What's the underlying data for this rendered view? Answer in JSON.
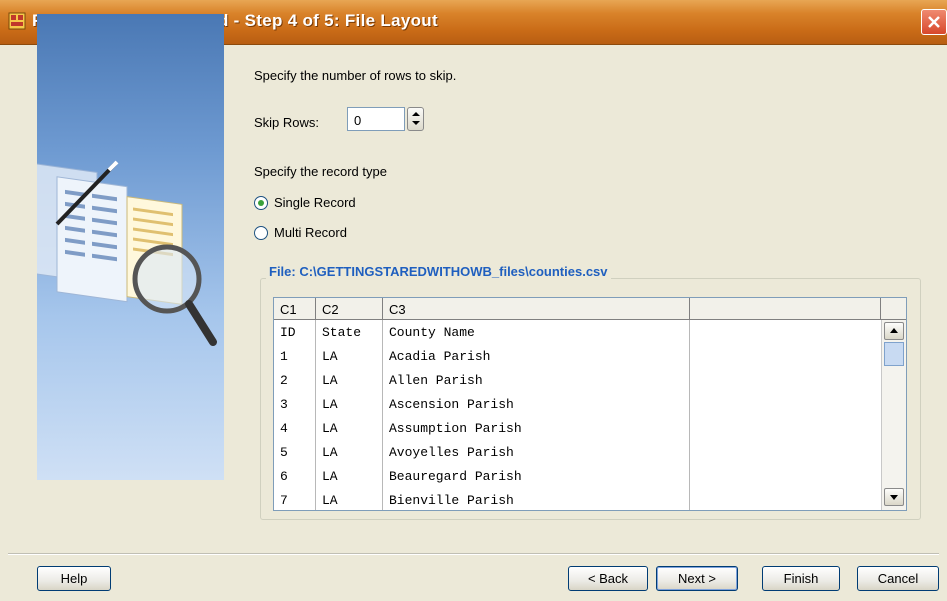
{
  "window": {
    "title": "Flat File Sample Wizard - Step 4 of 5: File Layout"
  },
  "skip": {
    "instruction": "Specify the number of rows to skip.",
    "label": "Skip Rows:",
    "value": "0"
  },
  "record_type": {
    "instruction": "Specify the record type",
    "options": [
      {
        "label": "Single Record",
        "checked": true
      },
      {
        "label": "Multi Record",
        "checked": false
      }
    ]
  },
  "file": {
    "title": "File: C:\\GETTINGSTAREDWITHOWB_files\\counties.csv",
    "columns": [
      "C1",
      "C2",
      "C3"
    ],
    "rows": [
      [
        "ID",
        "State",
        "County Name"
      ],
      [
        "1",
        "LA",
        "Acadia Parish"
      ],
      [
        "2",
        "LA",
        "Allen Parish"
      ],
      [
        "3",
        "LA",
        "Ascension Parish"
      ],
      [
        "4",
        "LA",
        "Assumption Parish"
      ],
      [
        "5",
        "LA",
        "Avoyelles Parish"
      ],
      [
        "6",
        "LA",
        "Beauregard Parish"
      ],
      [
        "7",
        "LA",
        "Bienville Parish"
      ]
    ]
  },
  "buttons": {
    "help": "Help",
    "back": "< Back",
    "next": "Next >",
    "finish": "Finish",
    "cancel": "Cancel"
  },
  "colors": {
    "title_bar": "#c96b17",
    "group_title": "#1f5fbf",
    "dialog_bg": "#ece9d8"
  }
}
